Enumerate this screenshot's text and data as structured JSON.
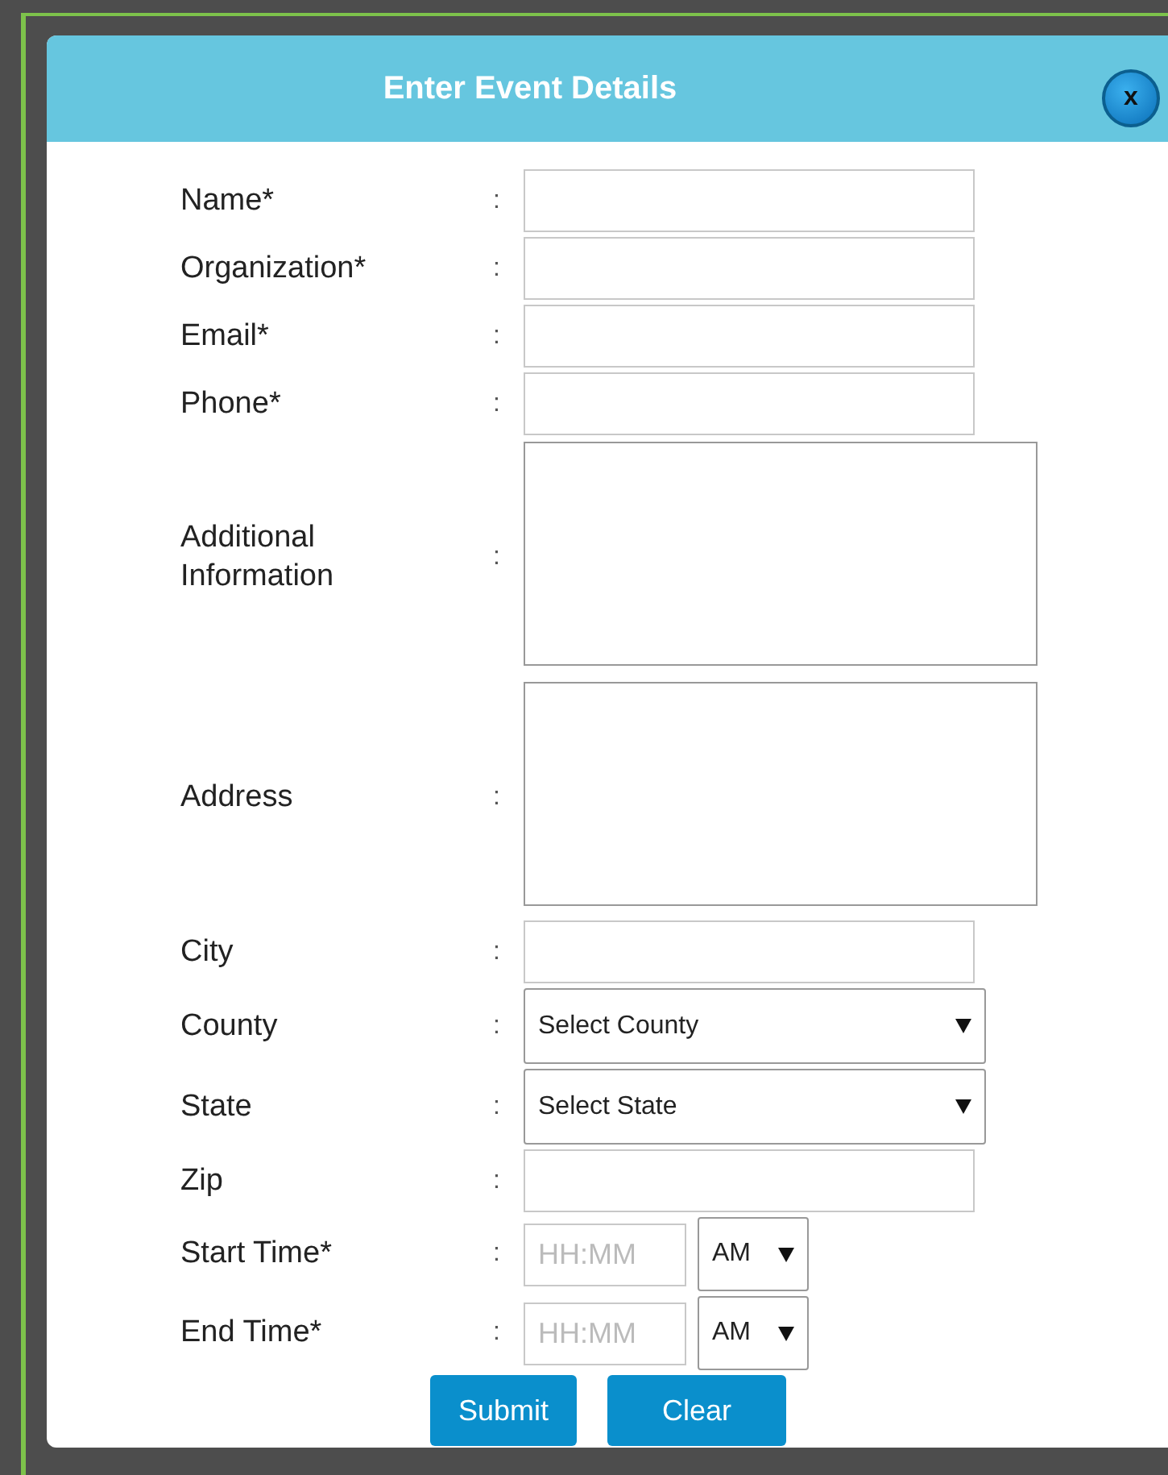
{
  "dialog": {
    "title": "Enter Event Details",
    "close_button": "x"
  },
  "fields": [
    {
      "kind": "text",
      "label": "Name*",
      "separator": ":"
    },
    {
      "kind": "text",
      "label": "Organization*",
      "separator": ":"
    },
    {
      "kind": "text",
      "label": "Email*",
      "separator": ":"
    },
    {
      "kind": "text",
      "label": "Phone*",
      "separator": ":"
    },
    {
      "kind": "textarea",
      "label": "Additional Information",
      "separator": ":"
    },
    {
      "kind": "textarea",
      "label": "Address",
      "separator": ":"
    },
    {
      "kind": "text",
      "label": "City",
      "separator": ":"
    },
    {
      "kind": "select",
      "label": "County",
      "separator": ":",
      "value": "Select County"
    },
    {
      "kind": "select",
      "label": "State",
      "separator": ":",
      "value": "Select State"
    },
    {
      "kind": "text",
      "label": "Zip",
      "separator": ":"
    },
    {
      "kind": "time",
      "label": "Start Time*",
      "separator": ":",
      "placeholder": "HH:MM",
      "meridiem": "AM"
    },
    {
      "kind": "time",
      "label": "End Time*",
      "separator": ":",
      "placeholder": "HH:MM",
      "meridiem": "AM"
    }
  ],
  "buttons": [
    "Submit",
    "Clear"
  ]
}
